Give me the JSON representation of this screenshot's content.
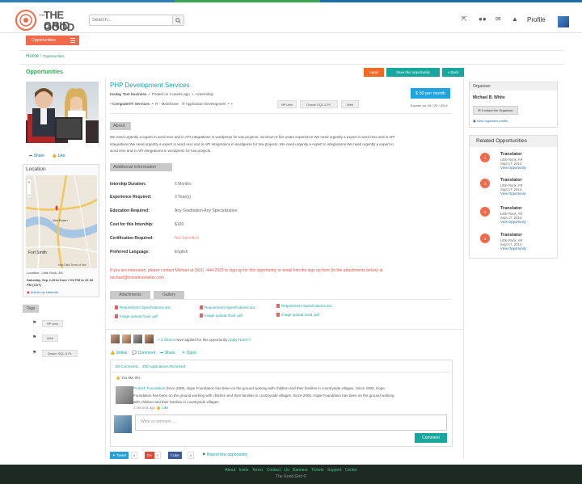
{
  "header": {
    "logo_text_top": "THE GOOD",
    "logo_text_bottom": "GRID",
    "search_placeholder": "Search...",
    "profile_label": "Profile"
  },
  "nav": {
    "tab_label": "Opportunities"
  },
  "breadcrumb": {
    "home": "Home",
    "sep": " / ",
    "current": "Opportunities"
  },
  "page": {
    "title": "Opportunities",
    "apply_label": "Apply",
    "save_label": "Save this opportunity",
    "back_label": "« Back"
  },
  "job": {
    "title": "PHP Development Services",
    "company": "Inoday Test business",
    "posted": "Posted on 4 weeks ago",
    "type": "Internship",
    "category": "Computer/IT Services",
    "subcat": "IT - Mainframe",
    "subcat2": "IT Application Development",
    "price": "$ 50 per month",
    "expires": "Expires on: 06 / 23 / 2014",
    "pills": [
      "HP Unix",
      "Oracle SQL & PL",
      "Web"
    ]
  },
  "sections": {
    "about": "About",
    "additional": "Additional Information",
    "attachments": "Attachments",
    "gallery": "Gallery"
  },
  "about_text": "We need urgently a expert in word ress and in API integrations in wordpress for tow projects. minimum 8 five years experience We need urgently a expert in word ress and in API integrations We need urgently a expert in word ress and in API integrations in wordpress for tow projects. We need urgently a expert in integrations We need urgently a expert in word ress and in API integrations in wordpress for tow projects.",
  "info": [
    {
      "label": "Intership Duration:",
      "value": "6 Months"
    },
    {
      "label": "Experience Required:",
      "value": "3 Year(s)"
    },
    {
      "label": "Education Required:",
      "value": "Any Graduation-Any Specialization"
    },
    {
      "label": "Cost for this Intership:",
      "value": "$100"
    },
    {
      "label": "Certification Required:",
      "value": "Not Specified"
    },
    {
      "label": "Preferred Language:",
      "value": "English"
    }
  ],
  "contact_text": "If you are interested, please contact Michael at (501) -444-2323 to sign up for this opportunity or email him the sign up form (in the attachments below) at michael@homelesshelter.com",
  "files": [
    "Requirement Specifications.doc",
    "Requirement Specifications.doc",
    "Requirement Specifications.doc",
    "Image upload Guid .pdf",
    "Image upload Guid .pdf",
    "Image upload Guid .pdf"
  ],
  "applied": {
    "others": "+ 3 Others",
    "text": "have applied for this opportunity",
    "apply_now": "Apply Now!>>"
  },
  "actions": {
    "unlike": "Unlike",
    "comment": "Comment",
    "share": "Share",
    "open": "Open"
  },
  "comments": {
    "count": "20 Comments",
    "received": "250 Applications Received",
    "likes": "You like this",
    "author": "Protech Foundation",
    "text": "Since 2005, Hope Foundation has been on the ground working with children and their families in countryside villages. Since 2005, Hope Foundation has been on the ground working with children and their families in countryside villages. Since 2005, Hope Foundation has been on the ground working with children and their families in countryside villages.",
    "time": "1 second ago",
    "like": "Like",
    "placeholder": "Write a comment.....",
    "submit": "Comment"
  },
  "social": {
    "tweet": "Tweet",
    "tweet_count": "0",
    "gplus": "G+",
    "gplus_count": "0",
    "fb": "Like",
    "fb_count": "0",
    "report": "Report this opportunity"
  },
  "left": {
    "share": "Share",
    "like": "Like",
    "location_title": "Location",
    "map_city": "Van Buren",
    "map_city2": "Fort Smith",
    "map_footer": "Map Data  Terms of Use",
    "location": "Location : Little Rock, AR.",
    "date": "Saturday, Sep 2,2014 from 7:00 PM to 10:00 PM (CDT)",
    "calendar": "Add to my calendar",
    "tags_label": "Tags",
    "tags": [
      "HP Unix",
      "Web",
      "Oracle SQL & PL"
    ]
  },
  "organizer": {
    "heading": "Organizer",
    "name": "Michael B. White",
    "contact": "Contact the Organizer",
    "view": "View organizer profile"
  },
  "related": {
    "heading": "Related Opportunities",
    "items": [
      {
        "num": "1",
        "title": "Translator",
        "city": "Little Rock, AR",
        "date": "Sept 17, 2014.",
        "link": "View Opportunity"
      },
      {
        "num": "3",
        "title": "Translator",
        "city": "Little Rock, AR",
        "date": "Sept 17, 2014.",
        "link": "View Opportunity"
      },
      {
        "num": "5",
        "title": "Translator",
        "city": "Little Rock, AR",
        "date": "Sept 17, 2014.",
        "link": "View Opportunity"
      },
      {
        "num": "4",
        "title": "Translator",
        "city": "Little Rock, AR",
        "date": "Sept 17, 2014.",
        "link": "View Opportunity"
      }
    ]
  },
  "footer": {
    "links": [
      "About",
      "Invite",
      "Terms",
      "Contact Us",
      "Banners",
      "Tickets",
      "Support Center"
    ],
    "copy": "The Good Grid ©"
  },
  "colors": {
    "accent": "#3aa457",
    "orange": "#f26a4b",
    "teal": "#1aa3a3",
    "blue": "#1ea4e0"
  }
}
